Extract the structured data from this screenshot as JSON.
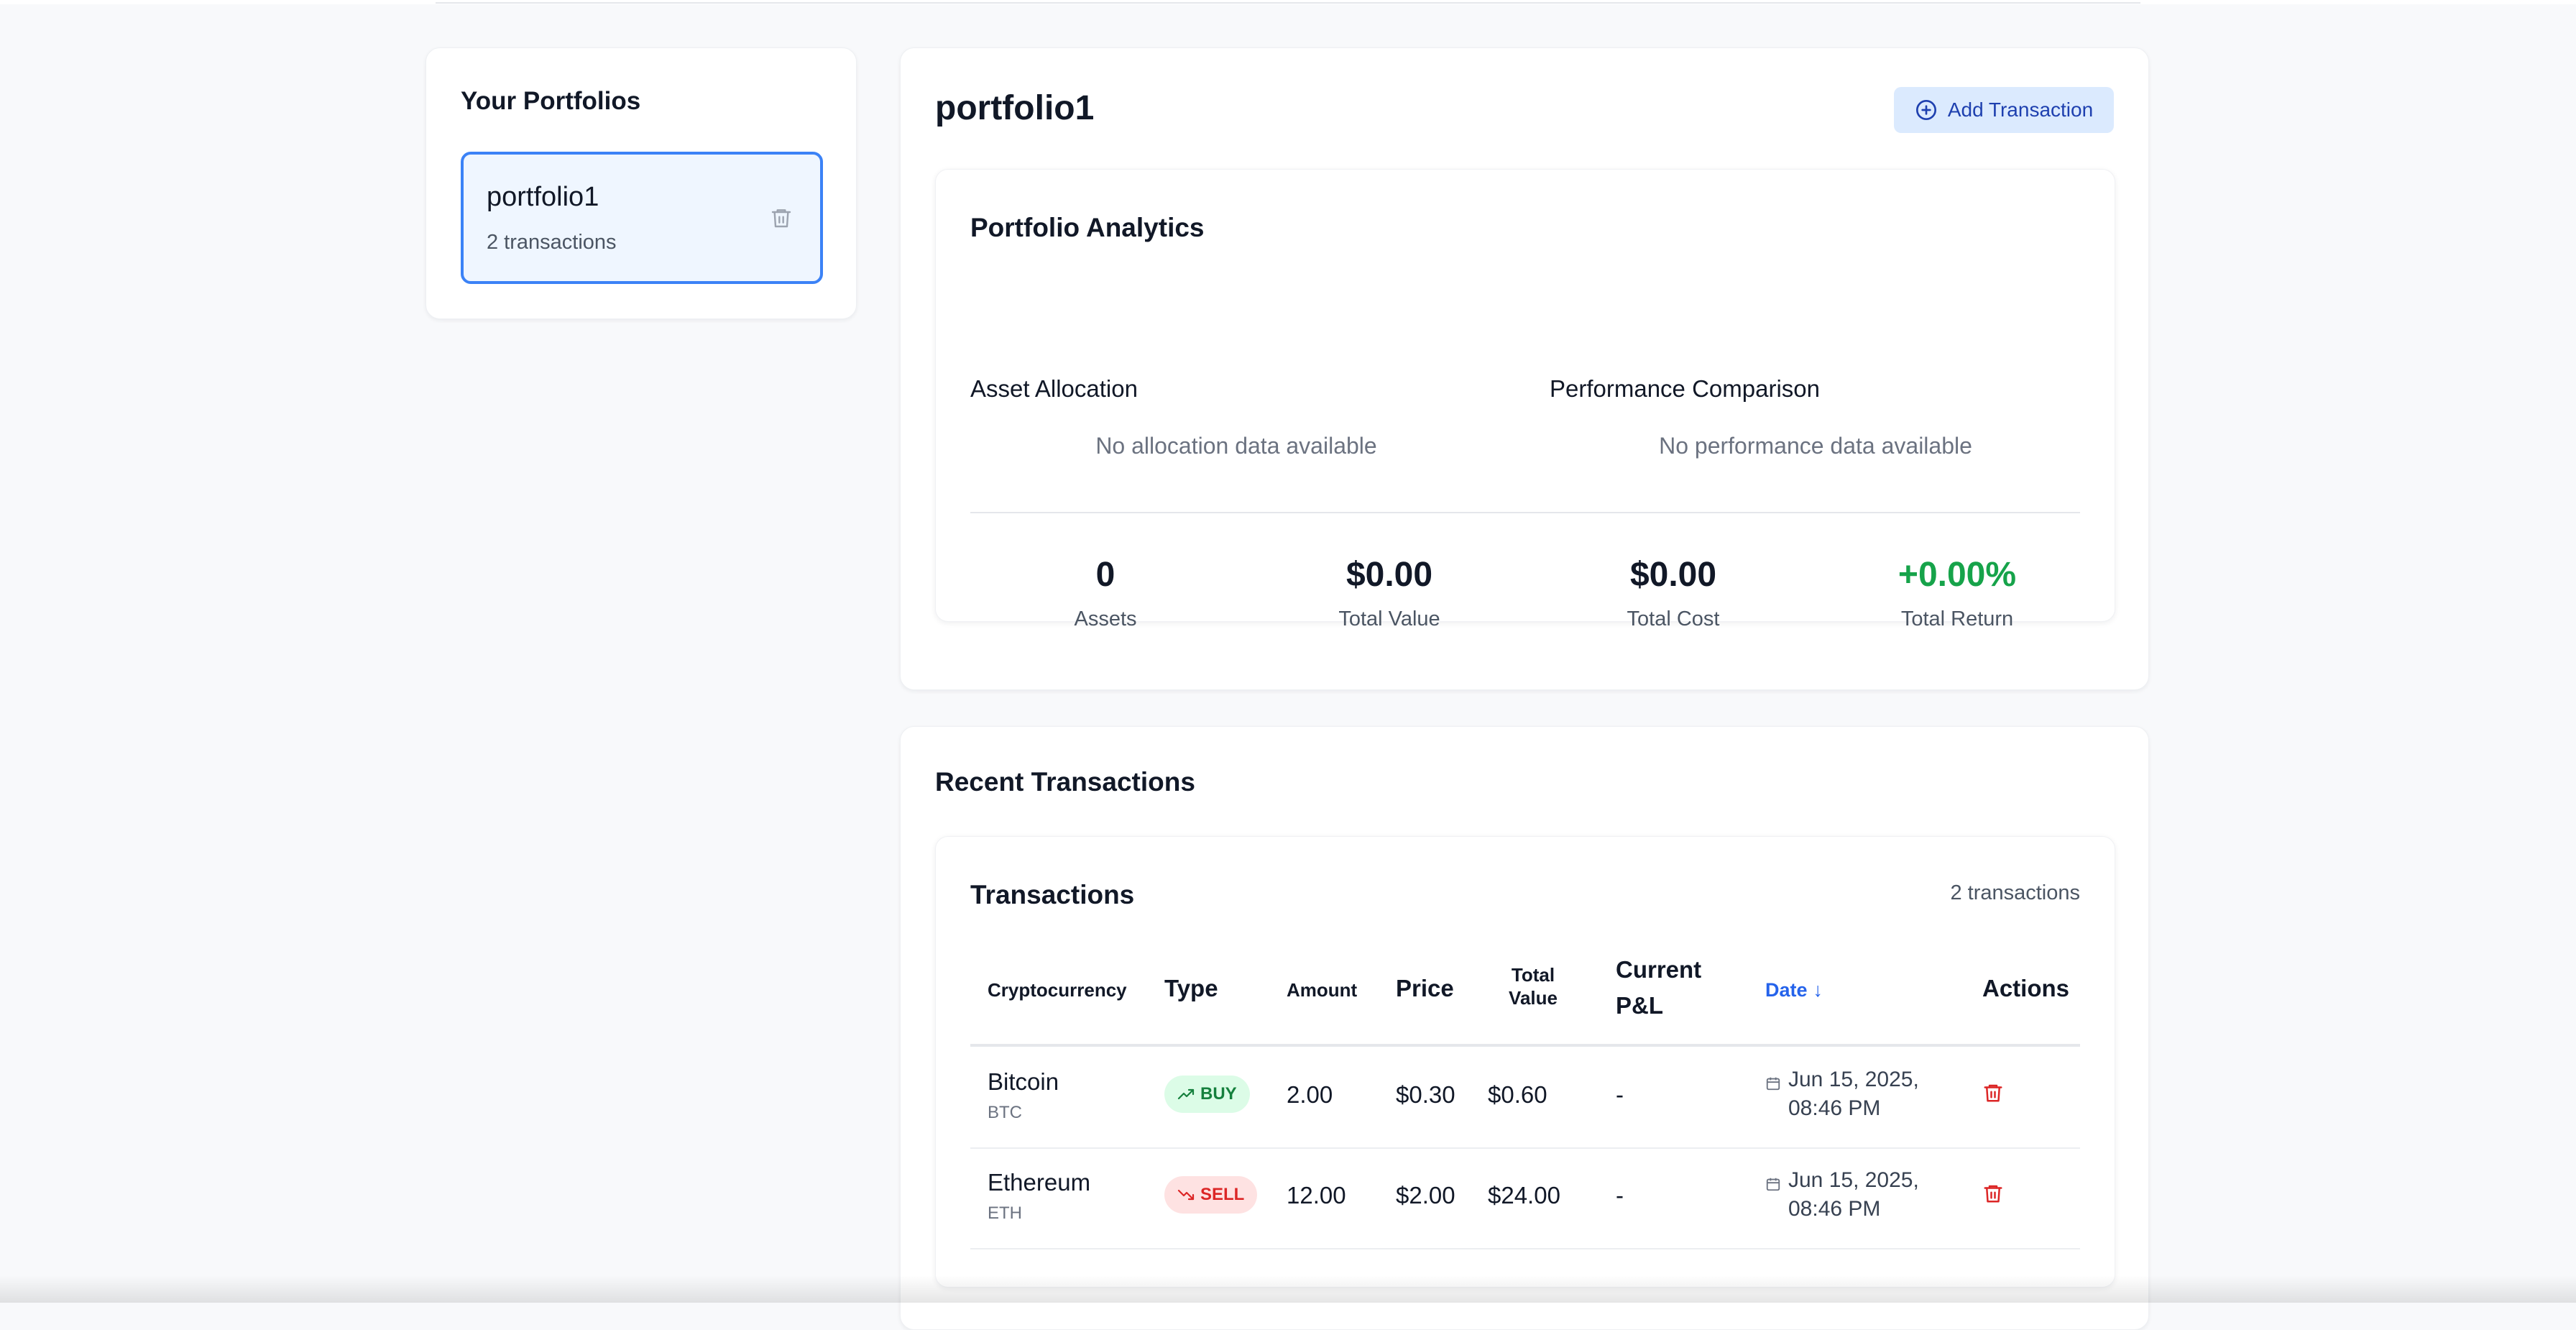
{
  "sidebar": {
    "title": "Your Portfolios",
    "portfolios": [
      {
        "name": "portfolio1",
        "count": "2 transactions"
      }
    ]
  },
  "portfolio": {
    "title": "portfolio1",
    "add_button_label": "Add Transaction",
    "analytics": {
      "title": "Portfolio Analytics",
      "allocation_title": "Asset Allocation",
      "allocation_empty": "No allocation data available",
      "performance_title": "Performance Comparison",
      "performance_empty": "No performance data available",
      "stats": {
        "assets": {
          "value": "0",
          "label": "Assets"
        },
        "total_value": {
          "value": "$0.00",
          "label": "Total Value"
        },
        "total_cost": {
          "value": "$0.00",
          "label": "Total Cost"
        },
        "total_return": {
          "value": "+0.00%",
          "label": "Total Return"
        }
      }
    }
  },
  "recent": {
    "title": "Recent Transactions",
    "table_title": "Transactions",
    "count": "2 transactions",
    "headers": {
      "crypto": "Cryptocurrency",
      "type": "Type",
      "amount": "Amount",
      "price": "Price",
      "total_value": "Total Value",
      "pnl": "Current P&L",
      "date": "Date",
      "date_sort": "↓",
      "actions": "Actions"
    },
    "rows": [
      {
        "name": "Bitcoin",
        "symbol": "BTC",
        "type": "BUY",
        "amount": "2.00",
        "price": "$0.30",
        "total": "$0.60",
        "pnl": "-",
        "date": "Jun 15, 2025, 08:46 PM"
      },
      {
        "name": "Ethereum",
        "symbol": "ETH",
        "type": "SELL",
        "amount": "12.00",
        "price": "$2.00",
        "total": "$24.00",
        "pnl": "-",
        "date": "Jun 15, 2025, 08:46 PM"
      }
    ]
  },
  "colors": {
    "accent": "#3b82f6",
    "buy": "#15803d",
    "sell": "#dc2626",
    "positive_return": "#16a34a"
  },
  "icons": {
    "portfolio_delete": "trash-icon",
    "add": "plus-circle-icon",
    "buy": "trending-up-icon",
    "sell": "trending-down-icon",
    "date": "calendar-icon",
    "row_delete": "trash-icon"
  }
}
